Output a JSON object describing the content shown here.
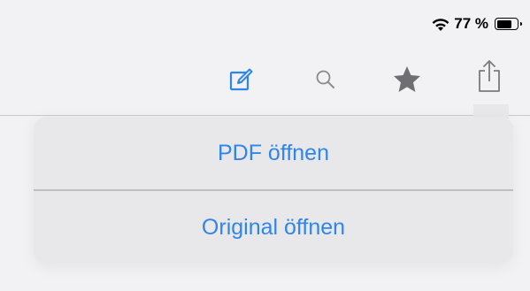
{
  "status_bar": {
    "wifi_icon": "wifi-icon",
    "battery_percent_text": "77 %",
    "battery_level": 0.77
  },
  "toolbar": {
    "buttons": [
      {
        "icon": "edit-icon",
        "color": "#2f86e8"
      },
      {
        "icon": "search-icon",
        "color": "#8a8a8f"
      },
      {
        "icon": "star-icon",
        "color": "#6f6f73"
      },
      {
        "icon": "share-icon",
        "color": "#7a7a7f"
      }
    ]
  },
  "menu": {
    "items": [
      {
        "label": "PDF öffnen"
      },
      {
        "label": "Original öffnen"
      }
    ],
    "accent_color": "#2f86e8"
  }
}
